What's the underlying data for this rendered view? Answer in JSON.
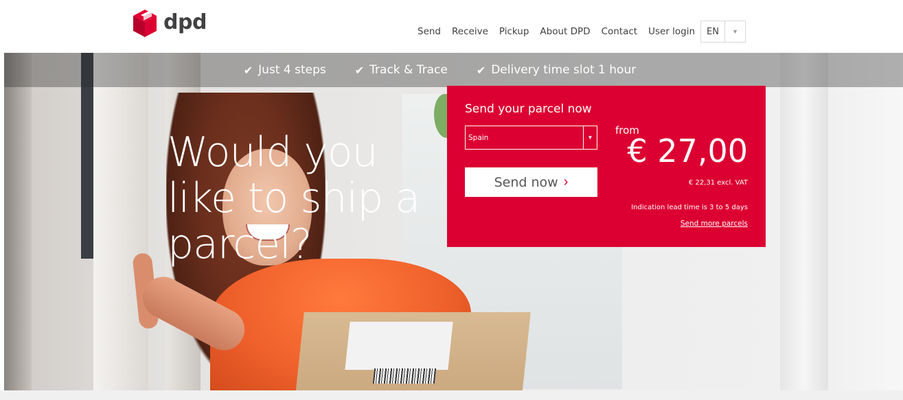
{
  "brand": {
    "name": "dpd",
    "color": "#dc0032"
  },
  "nav": {
    "items": [
      "Send",
      "Receive",
      "Pickup",
      "About DPD",
      "Contact",
      "User login"
    ],
    "language": "EN"
  },
  "hero": {
    "features": [
      "Just 4 steps",
      "Track & Trace",
      "Delivery time slot 1 hour"
    ],
    "headline": "Would you like to ship a parcel?"
  },
  "panel": {
    "title": "Send your parcel now",
    "country": "Spain",
    "button": "Send now",
    "from_label": "from",
    "price": "€ 27,00",
    "price_excl": "€ 22,31 excl. VAT",
    "lead_time": "Indication lead time is 3 to 5 days",
    "more_link": "Send more parcels"
  }
}
